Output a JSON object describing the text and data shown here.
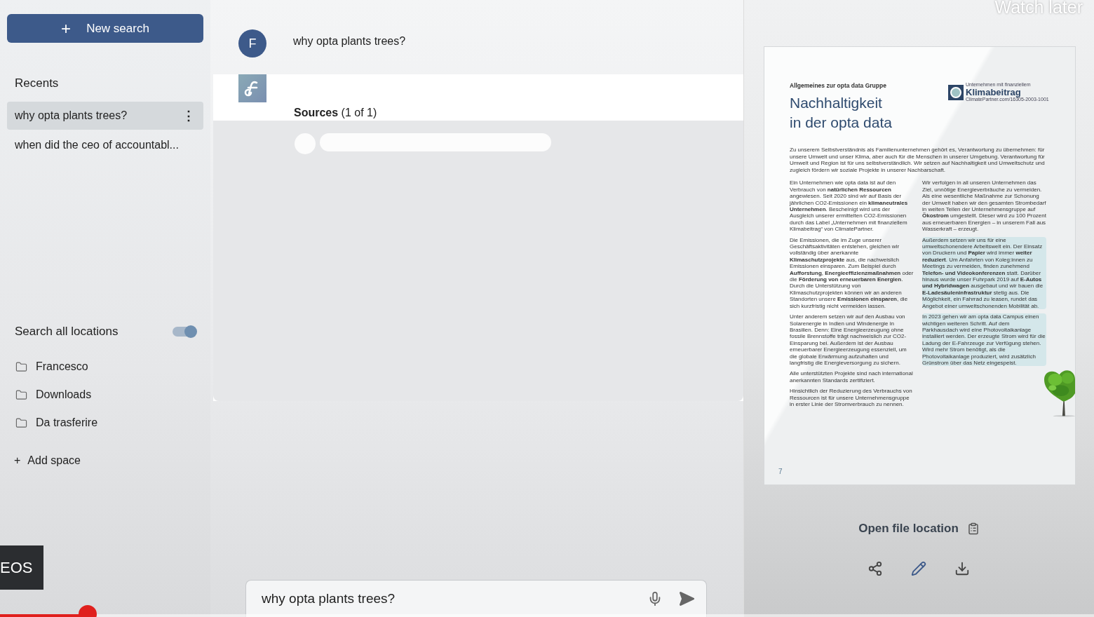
{
  "sidebar": {
    "new_search": {
      "icon": "+",
      "label": "New search"
    },
    "recents_title": "Recents",
    "recents": [
      {
        "label": "why opta plants trees?",
        "selected": true,
        "menu": "⋮"
      },
      {
        "label": "when did the ceo of accountabl...",
        "selected": false
      }
    ],
    "search_all": {
      "label": "Search all locations",
      "on": true
    },
    "locations": [
      {
        "label": "Francesco"
      },
      {
        "label": "Downloads"
      },
      {
        "label": "Da trasferire"
      }
    ],
    "add_space": {
      "icon": "+",
      "label": "Add space"
    }
  },
  "chat": {
    "user_avatar": "F",
    "question": "why opta plants trees?",
    "sources_title": "Sources",
    "sources_count": "(1 of 1)",
    "input": {
      "value": "why opta plants trees?"
    }
  },
  "preview": {
    "document": {
      "kicker": "Allgemeines zur opta data Gruppe",
      "title_lines": [
        "Nachhaltigkeit",
        "in der opta data"
      ],
      "badge": {
        "top": "Unternehmen mit finanziellem",
        "name": "Klimabeitrag",
        "bottom": "ClimatePartner.com/16305-2003-1001"
      },
      "intro": "Zu unserem Selbstverständnis als Familienunternehmen gehört es, Verantwortung zu übernehmen: für unsere Umwelt und unser Klima, aber auch für die Menschen in unserer Umgebung. Verantwortung für Umwelt und Region ist für uns selbstverständlich. Wir setzen auf Nachhaltigkeit und Umweltschutz und zugleich fördern wir soziale Projekte in unserer Nachbarschaft.",
      "left_column": [
        "Ein Unternehmen wie opta data ist auf den Verbrauch von **natürlichen Ressourcen** angewiesen. Seit 2020 sind wir auf Basis der jährlichen CO2-Emissionen ein **klimaneutrales Unternehmen**. Bescheinigt wird uns der Ausgleich unserer ermittelten CO2-Emissionen durch das Label „Unternehmen mit finanziellem Klimabeitrag“ von ClimatePartner.",
        "Die Emissionen, die im Zuge unserer Geschäftsaktivitäten entstehen, gleichen wir vollständig über anerkannte **Klimaschutzprojekte** aus, die nachweislich Emissionen einsparen. Zum Beispiel durch **Aufforstung**, **Energieeffizienzmaßnahmen** oder die **Förderung von erneuerbaren Energien**. Durch die Unterstützung von Klimaschutzprojekten können wir an anderen Standorten unsere **Emissionen einsparen**, die sich kurzfristig nicht vermeiden lassen.",
        "Unter anderem setzen wir auf den Ausbau von Solarenergie in Indien und Windenergie in Brasilien. Denn: Eine Energieerzeugung ohne fossile Brennstoffe trägt nachweislich zur CO2-Einsparung bei. Außerdem ist der Ausbau erneuerbarer Energieerzeugung essenziell, um die globale Erwärmung aufzuhalten und langfristig die Energieversorgung zu sichern.",
        "Alle unterstützten Projekte sind nach international anerkannten Standards zertifiziert.",
        "Hinsichtlich der Reduzierung des Verbrauchs von Ressourcen ist für unsere Unternehmensgruppe in erster Linie der Stromverbrauch zu nennen."
      ],
      "right_column": [
        "Wir verfolgen in all unseren Unternehmen das Ziel, unnötige Energieverbräuche zu vermeiden. Als eine wesentliche Maßnahme zur Schonung der Umwelt haben wir den gesamten Strombedarf in weiten Teilen der Unternehmensgruppe auf **Ökostrom** umgestellt. Dieser wird zu 100 Prozent aus erneuerbaren Energien – in unserem Fall aus Wasserkraft – erzeugt.",
        "Außerdem setzen wir uns für eine umweltschonendere Arbeitswelt ein. Der Einsatz von Druckern und **Papier** wird immer **weiter reduziert**. Um Anfahrten von Koleg:innen zu Meetings zu vermeiden, finden zunehmend **Telefon- und Videokonferenzen** statt. Darüber hinaus wurde unser Fuhrpark 2019 auf **E-Autos und Hybridwagen** ausgebaut und wir bauen die **E-Ladesäuleninfrastruktur** stetig aus. Die Möglichkeit, ein Fahrrad zu leasen, rundet das Angebot einer umweltschonenden Mobilität ab.",
        "In 2023 gehen wir am opta data Campus einen wichtigen weiteren Schritt. Auf dem Parkhausdach wird eine Photovoltaikanlage installiert werden. Der erzeugte Strom wird für die Ladung der E-Fahrzeuge zur Verfügung stehen. Wird mehr Strom benötigt, als die Photovoltaikanlage produziert, wird zusätzlich Grünstrom über das Netz eingespeist."
      ],
      "page_number": "7"
    },
    "open_file_location": "Open file location"
  },
  "video_overlay": {
    "watch_later": "Watch later",
    "badge": "EOS",
    "progress": {
      "level": 0.08
    }
  }
}
